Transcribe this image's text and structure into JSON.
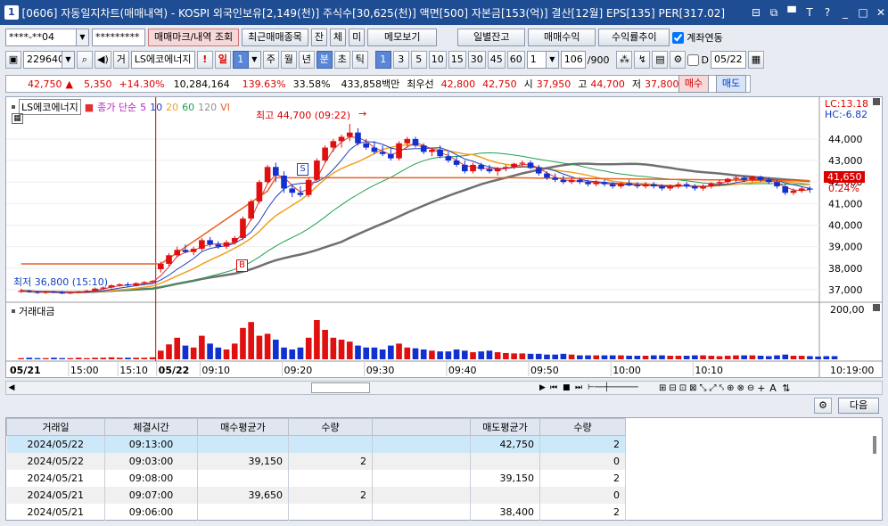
{
  "window": {
    "number": "1",
    "title": "[0606] 자동일지차트(매매내역) - KOSPI 외국인보유[2,149(천)] 주식수[30,625(천)] 액면[500] 자본금[153(억)] 결산[12월] EPS[135] PER[317.02]",
    "controls": [
      "⊟",
      "⧉",
      "▀",
      "T",
      "?",
      "_",
      "□",
      "✕"
    ]
  },
  "toolbar1": {
    "account": "****-**04",
    "password": "*********",
    "btn_trade_mark": "매매마크/내역 조회",
    "btn_recent": "최근매매종목",
    "btn_jan": "잔",
    "btn_che": "체",
    "btn_mi": "미",
    "btn_memo": "메모보기",
    "btn_daily": "일별잔고",
    "btn_profit": "매매수익",
    "btn_trend": "수익률추이",
    "chk_link": "계좌연동"
  },
  "toolbar2": {
    "code": "229640",
    "stock_name": "LS에코에너지",
    "tag": "거",
    "period_btns": [
      "일",
      "주",
      "월",
      "년",
      "분",
      "초",
      "틱"
    ],
    "num_btns": [
      "1",
      "3",
      "5",
      "10",
      "15",
      "30",
      "45",
      "60"
    ],
    "interval": "1",
    "count": "106",
    "count_total": "/900",
    "date": "05/22",
    "sel_period_value": "1",
    "checkbox_label": "D"
  },
  "quote": {
    "price": "42,750",
    "sign": "▲",
    "change": "5,350",
    "rate": "+14.30%",
    "volume": "10,284,164",
    "vol_rate": "139.63%",
    "turnover_rate": "33.58%",
    "amount": "433,858백만",
    "sell_label": "최우선",
    "ask": "42,800",
    "bid": "42,750",
    "open_label": "시",
    "open": "37,950",
    "high_label": "고",
    "high": "44,700",
    "low_label": "저",
    "low": "37,800",
    "buy_btn": "매수",
    "sell_btn": "매도"
  },
  "chart": {
    "legend": {
      "name": "LS에코에너지",
      "title": "종가 단순",
      "ma": [
        "5",
        "10",
        "20",
        "60",
        "120"
      ],
      "vi": "VI"
    },
    "lc": "LC:13.18",
    "hc": "HC:-6.82",
    "current_price": "41,650",
    "current_pct": "0.24%",
    "high_note": "최고 44,700 (09:22)",
    "low_note": "최저 36,800 (15:10)",
    "y_ticks": [
      "44,000",
      "43,000",
      "42,000",
      "41,000",
      "40,000",
      "39,000",
      "38,000",
      "37,000"
    ],
    "vol_label": "거래대금",
    "vol_tick": "200,00",
    "x_labels": [
      "05/21",
      "15:00",
      "15:10",
      "05/22",
      "09:10",
      "09:20",
      "09:30",
      "09:40",
      "09:50",
      "10:00",
      "10:10",
      "10:19:00"
    ],
    "marker_s": "S",
    "marker_b": "B"
  },
  "chart_data": {
    "type": "candlestick",
    "ylim": [
      36500,
      44700
    ],
    "candles": [
      {
        "o": 36900,
        "h": 37050,
        "l": 36850,
        "c": 36950
      },
      {
        "o": 36950,
        "h": 37000,
        "l": 36850,
        "c": 36900
      },
      {
        "o": 36900,
        "h": 36950,
        "l": 36800,
        "c": 36850
      },
      {
        "o": 36850,
        "h": 36950,
        "l": 36800,
        "c": 36900
      },
      {
        "o": 36900,
        "h": 36950,
        "l": 36850,
        "c": 36880
      },
      {
        "o": 36880,
        "h": 36950,
        "l": 36800,
        "c": 36820
      },
      {
        "o": 36820,
        "h": 36900,
        "l": 36800,
        "c": 36880
      },
      {
        "o": 36880,
        "h": 36950,
        "l": 36850,
        "c": 36900
      },
      {
        "o": 36900,
        "h": 37000,
        "l": 36850,
        "c": 36950
      },
      {
        "o": 36950,
        "h": 37100,
        "l": 36900,
        "c": 37050
      },
      {
        "o": 37050,
        "h": 37150,
        "l": 37000,
        "c": 37100
      },
      {
        "o": 37100,
        "h": 37250,
        "l": 37050,
        "c": 37200
      },
      {
        "o": 37200,
        "h": 37300,
        "l": 37150,
        "c": 37250
      },
      {
        "o": 37250,
        "h": 37350,
        "l": 37150,
        "c": 37200
      },
      {
        "o": 37200,
        "h": 37350,
        "l": 37150,
        "c": 37300
      },
      {
        "o": 37300,
        "h": 37400,
        "l": 37250,
        "c": 37350
      },
      {
        "o": 37350,
        "h": 37450,
        "l": 37300,
        "c": 37400
      },
      {
        "o": 37950,
        "h": 38300,
        "l": 37800,
        "c": 38200
      },
      {
        "o": 38200,
        "h": 38700,
        "l": 38100,
        "c": 38600
      },
      {
        "o": 38600,
        "h": 39000,
        "l": 38500,
        "c": 38850
      },
      {
        "o": 38850,
        "h": 39100,
        "l": 38700,
        "c": 38750
      },
      {
        "o": 38750,
        "h": 39000,
        "l": 38600,
        "c": 38900
      },
      {
        "o": 38900,
        "h": 39400,
        "l": 38800,
        "c": 39300
      },
      {
        "o": 39300,
        "h": 39450,
        "l": 39000,
        "c": 39100
      },
      {
        "o": 39100,
        "h": 39250,
        "l": 38900,
        "c": 39000
      },
      {
        "o": 39000,
        "h": 39300,
        "l": 38900,
        "c": 39200
      },
      {
        "o": 39200,
        "h": 39500,
        "l": 39100,
        "c": 39400
      },
      {
        "o": 39400,
        "h": 40400,
        "l": 39300,
        "c": 40300
      },
      {
        "o": 40300,
        "h": 41200,
        "l": 40200,
        "c": 41100
      },
      {
        "o": 41100,
        "h": 42100,
        "l": 41000,
        "c": 42000
      },
      {
        "o": 42000,
        "h": 42800,
        "l": 41900,
        "c": 42700
      },
      {
        "o": 42700,
        "h": 42900,
        "l": 42000,
        "c": 42300
      },
      {
        "o": 42300,
        "h": 42500,
        "l": 41500,
        "c": 41700
      },
      {
        "o": 41700,
        "h": 41900,
        "l": 41300,
        "c": 41500
      },
      {
        "o": 41500,
        "h": 41800,
        "l": 41300,
        "c": 41400
      },
      {
        "o": 41400,
        "h": 42200,
        "l": 41300,
        "c": 42100
      },
      {
        "o": 42100,
        "h": 43100,
        "l": 42000,
        "c": 43000
      },
      {
        "o": 43000,
        "h": 43700,
        "l": 42900,
        "c": 43600
      },
      {
        "o": 43600,
        "h": 44000,
        "l": 43400,
        "c": 43900
      },
      {
        "o": 43900,
        "h": 44200,
        "l": 43600,
        "c": 44100
      },
      {
        "o": 44100,
        "h": 44700,
        "l": 43900,
        "c": 44300
      },
      {
        "o": 44300,
        "h": 44500,
        "l": 43700,
        "c": 43800
      },
      {
        "o": 43800,
        "h": 44000,
        "l": 43500,
        "c": 43600
      },
      {
        "o": 43600,
        "h": 43900,
        "l": 43300,
        "c": 43400
      },
      {
        "o": 43400,
        "h": 43700,
        "l": 43200,
        "c": 43300
      },
      {
        "o": 43300,
        "h": 43600,
        "l": 43000,
        "c": 43100
      },
      {
        "o": 43100,
        "h": 43900,
        "l": 43000,
        "c": 43800
      },
      {
        "o": 43800,
        "h": 44100,
        "l": 43600,
        "c": 44000
      },
      {
        "o": 44000,
        "h": 44100,
        "l": 43600,
        "c": 43700
      },
      {
        "o": 43700,
        "h": 43800,
        "l": 43300,
        "c": 43400
      },
      {
        "o": 43400,
        "h": 43600,
        "l": 43200,
        "c": 43500
      },
      {
        "o": 43500,
        "h": 43700,
        "l": 43100,
        "c": 43200
      },
      {
        "o": 43200,
        "h": 43400,
        "l": 42900,
        "c": 43000
      },
      {
        "o": 43000,
        "h": 43200,
        "l": 42700,
        "c": 42800
      },
      {
        "o": 42800,
        "h": 43000,
        "l": 42400,
        "c": 42500
      },
      {
        "o": 42500,
        "h": 42900,
        "l": 42400,
        "c": 42800
      },
      {
        "o": 42800,
        "h": 42900,
        "l": 42500,
        "c": 42600
      },
      {
        "o": 42600,
        "h": 42800,
        "l": 42400,
        "c": 42500
      },
      {
        "o": 42500,
        "h": 42700,
        "l": 42300,
        "c": 42650
      },
      {
        "o": 42650,
        "h": 42800,
        "l": 42500,
        "c": 42700
      },
      {
        "o": 42700,
        "h": 42900,
        "l": 42600,
        "c": 42850
      },
      {
        "o": 42850,
        "h": 43000,
        "l": 42700,
        "c": 42900
      },
      {
        "o": 42900,
        "h": 43000,
        "l": 42600,
        "c": 42650
      },
      {
        "o": 42650,
        "h": 42800,
        "l": 42300,
        "c": 42400
      },
      {
        "o": 42400,
        "h": 42500,
        "l": 42100,
        "c": 42200
      },
      {
        "o": 42200,
        "h": 42400,
        "l": 42000,
        "c": 42100
      },
      {
        "o": 42100,
        "h": 42300,
        "l": 41900,
        "c": 42000
      },
      {
        "o": 42000,
        "h": 42200,
        "l": 41900,
        "c": 42100
      },
      {
        "o": 42100,
        "h": 42200,
        "l": 41900,
        "c": 42000
      },
      {
        "o": 42000,
        "h": 42100,
        "l": 41800,
        "c": 41900
      },
      {
        "o": 41900,
        "h": 42100,
        "l": 41800,
        "c": 42000
      },
      {
        "o": 42000,
        "h": 42100,
        "l": 41800,
        "c": 41900
      },
      {
        "o": 41900,
        "h": 42000,
        "l": 41700,
        "c": 41800
      },
      {
        "o": 41800,
        "h": 42000,
        "l": 41700,
        "c": 41950
      },
      {
        "o": 41950,
        "h": 42100,
        "l": 41800,
        "c": 41850
      },
      {
        "o": 41850,
        "h": 42000,
        "l": 41700,
        "c": 41800
      },
      {
        "o": 41800,
        "h": 42000,
        "l": 41700,
        "c": 41900
      },
      {
        "o": 41900,
        "h": 42000,
        "l": 41700,
        "c": 41800
      },
      {
        "o": 41800,
        "h": 41900,
        "l": 41600,
        "c": 41700
      },
      {
        "o": 41700,
        "h": 41900,
        "l": 41600,
        "c": 41800
      },
      {
        "o": 41800,
        "h": 42000,
        "l": 41700,
        "c": 41900
      },
      {
        "o": 41900,
        "h": 42000,
        "l": 41700,
        "c": 41800
      },
      {
        "o": 41800,
        "h": 41900,
        "l": 41600,
        "c": 41700
      },
      {
        "o": 41700,
        "h": 41900,
        "l": 41600,
        "c": 41800
      },
      {
        "o": 41800,
        "h": 42000,
        "l": 41700,
        "c": 41950
      },
      {
        "o": 41950,
        "h": 42100,
        "l": 41800,
        "c": 42000
      },
      {
        "o": 42000,
        "h": 42200,
        "l": 41900,
        "c": 42150
      },
      {
        "o": 42150,
        "h": 42300,
        "l": 42000,
        "c": 42200
      },
      {
        "o": 42200,
        "h": 42300,
        "l": 42000,
        "c": 42100
      },
      {
        "o": 42100,
        "h": 42300,
        "l": 42000,
        "c": 42250
      },
      {
        "o": 42250,
        "h": 42300,
        "l": 42000,
        "c": 42100
      },
      {
        "o": 42100,
        "h": 42200,
        "l": 41900,
        "c": 42000
      },
      {
        "o": 42000,
        "h": 42100,
        "l": 41700,
        "c": 41800
      },
      {
        "o": 41800,
        "h": 41900,
        "l": 41400,
        "c": 41500
      },
      {
        "o": 41500,
        "h": 41700,
        "l": 41400,
        "c": 41600
      },
      {
        "o": 41600,
        "h": 41800,
        "l": 41500,
        "c": 41700
      },
      {
        "o": 41700,
        "h": 41800,
        "l": 41500,
        "c": 41650
      }
    ],
    "volume": [
      3,
      4,
      3,
      3,
      4,
      3,
      3,
      4,
      3,
      4,
      4,
      5,
      4,
      4,
      4,
      4,
      5,
      22,
      38,
      55,
      35,
      30,
      60,
      40,
      30,
      25,
      40,
      80,
      95,
      60,
      65,
      50,
      30,
      25,
      30,
      55,
      100,
      75,
      55,
      50,
      45,
      35,
      30,
      30,
      25,
      35,
      40,
      30,
      28,
      25,
      22,
      20,
      20,
      25,
      22,
      18,
      20,
      22,
      18,
      16,
      15,
      15,
      14,
      14,
      12,
      12,
      14,
      12,
      10,
      10,
      10,
      10,
      10,
      10,
      9,
      9,
      9,
      10,
      10,
      9,
      9,
      9,
      10,
      10,
      9,
      8,
      9,
      10,
      10,
      10,
      9,
      8,
      10,
      12,
      9,
      9,
      8,
      7,
      8,
      8
    ],
    "ma_colors": {
      "ma5": "#e03030",
      "ma10": "#2040c0",
      "ma20": "#f0a020",
      "ma60": "#20a050",
      "ma120": "#707070",
      "vi": "#e86020"
    }
  },
  "bottom": {
    "btn_next": "다음",
    "headers": [
      "거래일",
      "체결시간",
      "매수평균가",
      "수량",
      "",
      "매도평균가",
      "수량"
    ],
    "rows": [
      [
        "2024/05/22",
        "09:13:00",
        "",
        "",
        "",
        "42,750",
        "2"
      ],
      [
        "2024/05/22",
        "09:03:00",
        "39,150",
        "2",
        "",
        "",
        "0"
      ],
      [
        "2024/05/21",
        "09:08:00",
        "",
        "",
        "",
        "39,150",
        "2"
      ],
      [
        "2024/05/21",
        "09:07:00",
        "39,650",
        "2",
        "",
        "",
        "0"
      ],
      [
        "2024/05/21",
        "09:06:00",
        "",
        "",
        "",
        "38,400",
        "2"
      ]
    ]
  }
}
